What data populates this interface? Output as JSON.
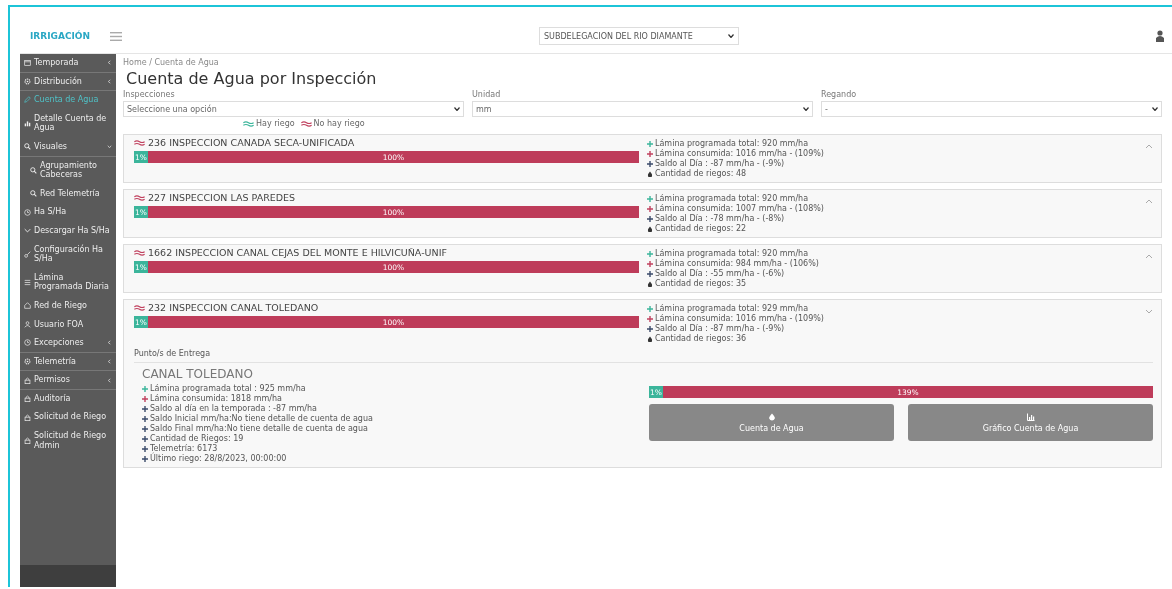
{
  "header": {
    "logo": "IRRIGACIÓN",
    "subdelegation": "SUBDELEGACION DEL RIO DIAMANTE"
  },
  "sidebar": {
    "items": [
      {
        "label": "Temporada",
        "selected": false,
        "expanded": false
      },
      {
        "label": "Distribución",
        "selected": false,
        "expanded": false
      },
      {
        "label": "Cuenta de Agua",
        "selected": true
      },
      {
        "label": "Detalle Cuenta de Agua",
        "selected": false
      },
      {
        "label": "Visuales",
        "selected": false,
        "expanded": true,
        "children": [
          {
            "label": "Agrupamiento Cabeceras",
            "selected": false
          },
          {
            "label": "Red Telemetría",
            "selected": false
          }
        ]
      },
      {
        "label": "Ha S/Ha",
        "selected": false
      },
      {
        "label": "Descargar Ha S/Ha",
        "selected": false
      },
      {
        "label": "Configuración Ha S/Ha",
        "selected": false
      },
      {
        "label": "Lámina Programada Diaria",
        "selected": false
      },
      {
        "label": "Red de Riego",
        "selected": false
      },
      {
        "label": "Usuario FOA",
        "selected": false
      },
      {
        "label": "Excepciones",
        "selected": false,
        "expanded": false
      },
      {
        "label": "Telemetría",
        "selected": false,
        "expanded": false
      },
      {
        "label": "Permisos",
        "selected": false,
        "expanded": false
      },
      {
        "label": "Auditoría",
        "selected": false
      },
      {
        "label": "Solicitud de Riego",
        "selected": false
      },
      {
        "label": "Solicitud de Riego Admin",
        "selected": false
      }
    ]
  },
  "breadcrumb": "Home / Cuenta de Agua",
  "title": "Cuenta de Agua por Inspección",
  "filters": [
    {
      "label": "Inspecciones",
      "value": "Seleccione una opción"
    },
    {
      "label": "Unidad",
      "value": "mm"
    },
    {
      "label": "Regando",
      "value": "-"
    }
  ],
  "legend": [
    {
      "label": "Hay riego",
      "riego": true
    },
    {
      "label": "No hay riego",
      "riego": false
    }
  ],
  "inspections": [
    {
      "title": "236 INSPECCION CANADA SECA-UNIFICADA",
      "riego": false,
      "expanded": false,
      "bar": [
        {
          "label": "1%",
          "level": 0.02,
          "kind": "riego"
        },
        {
          "label": "100%",
          "level": 0.98,
          "kind": "consumo"
        }
      ],
      "stats": [
        {
          "kind": "programada",
          "text": "Lámina programada total: 920 mm/ha"
        },
        {
          "kind": "consumida",
          "text": "Lámina consumida: 1016 mm/ha - (109%)"
        },
        {
          "kind": "saldo",
          "text": "Saldo al Día : -87 mm/ha - (-9%)"
        },
        {
          "kind": "riegos",
          "text": "Cantidad de riegos: 48"
        }
      ]
    },
    {
      "title": "227 INSPECCION LAS PAREDES",
      "riego": false,
      "expanded": false,
      "bar": [
        {
          "label": "1%",
          "level": 0.02,
          "kind": "riego"
        },
        {
          "label": "100%",
          "level": 0.98,
          "kind": "consumo"
        }
      ],
      "stats": [
        {
          "kind": "programada",
          "text": "Lámina programada total: 920 mm/ha"
        },
        {
          "kind": "consumida",
          "text": "Lámina consumida: 1007 mm/ha - (108%)"
        },
        {
          "kind": "saldo",
          "text": "Saldo al Día : -78 mm/ha - (-8%)"
        },
        {
          "kind": "riegos",
          "text": "Cantidad de riegos: 22"
        }
      ]
    },
    {
      "title": "1662 INSPECCION CANAL CEJAS DEL MONTE E HILVICUÑA-UNIF",
      "riego": false,
      "expanded": false,
      "bar": [
        {
          "label": "1%",
          "level": 0.02,
          "kind": "riego"
        },
        {
          "label": "100%",
          "level": 0.98,
          "kind": "consumo"
        }
      ],
      "stats": [
        {
          "kind": "programada",
          "text": "Lámina programada total: 920 mm/ha"
        },
        {
          "kind": "consumida",
          "text": "Lámina consumida: 984 mm/ha - (106%)"
        },
        {
          "kind": "saldo",
          "text": "Saldo al Día : -55 mm/ha - (-6%)"
        },
        {
          "kind": "riegos",
          "text": "Cantidad de riegos: 35"
        }
      ]
    },
    {
      "title": "232 INSPECCION CANAL TOLEDANO",
      "riego": false,
      "expanded": true,
      "bar": [
        {
          "label": "1%",
          "level": 0.02,
          "kind": "riego"
        },
        {
          "label": "100%",
          "level": 0.98,
          "kind": "consumo"
        }
      ],
      "stats": [
        {
          "kind": "programada",
          "text": "Lámina programada total: 929 mm/ha"
        },
        {
          "kind": "consumida",
          "text": "Lámina consumida: 1016 mm/ha - (109%)"
        },
        {
          "kind": "saldo",
          "text": "Saldo al Día : -87 mm/ha - (-9%)"
        },
        {
          "kind": "riegos",
          "text": "Cantidad de riegos: 36"
        }
      ],
      "delivery": {
        "heading": "Punto/s de Entrega",
        "name": "CANAL TOLEDANO",
        "lines": [
          {
            "kind": "programada",
            "text": "Lámina programada total : 925 mm/ha"
          },
          {
            "kind": "consumida",
            "text": "Lámina consumida: 1818 mm/ha"
          },
          {
            "kind": "saldo",
            "text": "Saldo al día en la temporada : -87 mm/ha"
          },
          {
            "kind": "saldo",
            "text": "Saldo Inicial mm/ha:No tiene detalle de cuenta de agua"
          },
          {
            "kind": "saldo",
            "text": "Saldo Final mm/ha:No tiene detalle de cuenta de agua"
          },
          {
            "kind": "saldo",
            "text": "Cantidad de Riegos: 19"
          },
          {
            "kind": "saldo",
            "text": "Telemetría: 6173"
          },
          {
            "kind": "saldo",
            "text": "Último riego: 28/8/2023, 00:00:00"
          }
        ],
        "bar": [
          {
            "label": "1%",
            "level": 0.015,
            "kind": "riego"
          },
          {
            "label": "139%",
            "level": 0.985,
            "kind": "consumo"
          }
        ],
        "buttons": [
          {
            "label": "Cuenta de Agua",
            "kind": "account"
          },
          {
            "label": "Gráfico Cuenta de Agua",
            "kind": "chart"
          }
        ]
      }
    }
  ]
}
